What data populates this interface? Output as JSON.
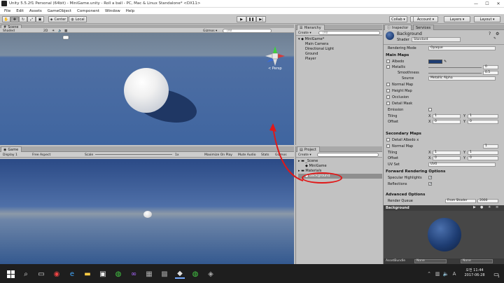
{
  "window": {
    "title": "Unity 5.5.2f1 Personal (64bit) - MiniGame.unity - Roll a ball - PC, Mac & Linux Standalone* <DX11>",
    "controls": [
      "—",
      "☐",
      "✕"
    ]
  },
  "menu": [
    "File",
    "Edit",
    "Assets",
    "GameObject",
    "Component",
    "Window",
    "Help"
  ],
  "toolbar": {
    "pivot_label": "Center",
    "space_label": "Local",
    "collab_label": "Collab ▾",
    "account_label": "Account ▾",
    "layers_label": "Layers ▾",
    "layout_label": "Layout ▾"
  },
  "scene_panel": {
    "tab_label": "Scene",
    "shading": "Shaded",
    "mode_2d": "2D",
    "gizmos": "Gizmos ▾",
    "search_placeholder": "(All",
    "persp_label": "< Persp"
  },
  "game_panel": {
    "tab_label": "Game",
    "display": "Display 1",
    "aspect": "Free Aspect",
    "scale_label": "Scale",
    "scale_value": "1x",
    "maximize": "Maximize On Play",
    "mute": "Mute Audio",
    "stats": "Stats",
    "gizmos": "Gizmos"
  },
  "hierarchy": {
    "tab_label": "Hierarchy",
    "create_label": "Create ▾",
    "search_placeholder": "(All",
    "scene_name": "MiniGame*",
    "items": [
      "Main Camera",
      "Directional Light",
      "Ground",
      "Player"
    ]
  },
  "project": {
    "tab_label": "Project",
    "create_label": "Create ▾",
    "items": [
      {
        "name": "_Scene",
        "indent": 0
      },
      {
        "name": "MiniGame",
        "indent": 1
      },
      {
        "name": "Materials",
        "indent": 0
      },
      {
        "name": "background",
        "indent": 1
      }
    ]
  },
  "inspector": {
    "tab_label": "Inspector",
    "services_tab": "Services",
    "material_name": "Background",
    "shader_label": "Shader",
    "shader_value": "Standard",
    "rendering_mode_label": "Rendering Mode",
    "rendering_mode_value": "Opaque",
    "main_maps": "Main Maps",
    "albedo": "Albedo",
    "metallic": "Metallic",
    "metallic_value": "0",
    "smoothness": "Smoothness",
    "smoothness_value": "0.5",
    "source_label": "Source",
    "source_value": "Metallic Alpha",
    "normal_map": "Normal Map",
    "height_map": "Height Map",
    "occlusion": "Occlusion",
    "detail_mask": "Detail Mask",
    "emission": "Emission",
    "tiling": "Tiling",
    "offset": "Offset",
    "x_label": "X",
    "y_label": "Y",
    "tiling_x": "1",
    "tiling_y": "1",
    "offset_x": "0",
    "offset_y": "0",
    "secondary_maps": "Secondary Maps",
    "detail_albedo": "Detail Albedo x",
    "sec_normal_map": "Normal Map",
    "sec_normal_value": "1",
    "sec_tiling_x": "1",
    "sec_tiling_y": "1",
    "sec_offset_x": "0",
    "sec_offset_y": "0",
    "uv_set_label": "UV Set",
    "uv_set_value": "UV0",
    "forward_options": "Forward Rendering Options",
    "specular_highlights": "Specular Highlights",
    "reflections": "Reflections",
    "advanced_options": "Advanced Options",
    "render_queue": "Render Queue",
    "render_queue_mode": "From Shader",
    "render_queue_value": "2000",
    "preview_title": "Background",
    "assetbundle_label": "AssetBundle",
    "assetbundle_value": "None",
    "assetbundle_variant": "None"
  },
  "taskbar": {
    "time": "오전 11:44",
    "date": "2017-06-28",
    "badge": "1"
  },
  "colors": {
    "annotation_red": "#e01818",
    "sphere": "#f2f2f2",
    "material_blue": "#1e3d73"
  }
}
